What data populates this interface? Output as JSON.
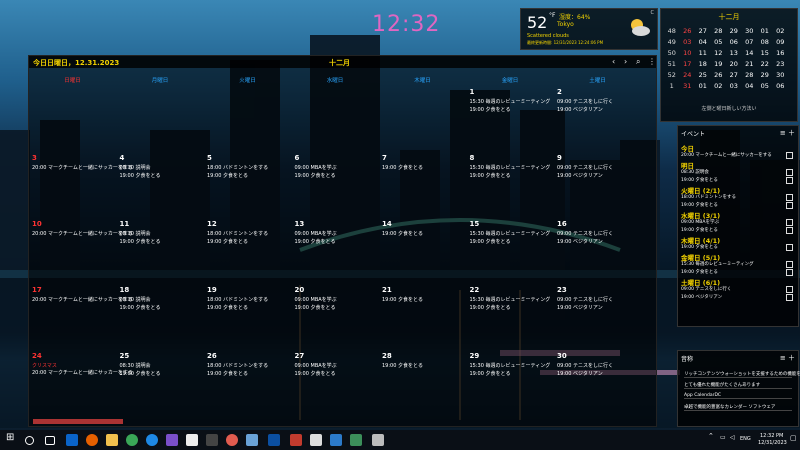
{
  "clock": "12:32",
  "weather": {
    "temp": "52",
    "unit": "°F",
    "humidity": "湿度：64%",
    "city": "Tokyo",
    "condition": "Scattered clouds",
    "updated": "最終更新時間: 12/31/2023 12:24:06 PM",
    "corner": "C"
  },
  "mini_calendar": {
    "title": "十二月",
    "rows": [
      [
        "48",
        "26",
        "27",
        "28",
        "29",
        "30",
        "01",
        "02"
      ],
      [
        "49",
        "03",
        "04",
        "05",
        "06",
        "07",
        "08",
        "09"
      ],
      [
        "50",
        "10",
        "11",
        "12",
        "13",
        "14",
        "15",
        "16"
      ],
      [
        "51",
        "17",
        "18",
        "19",
        "20",
        "21",
        "22",
        "23"
      ],
      [
        "52",
        "24",
        "25",
        "26",
        "27",
        "28",
        "29",
        "30"
      ],
      [
        "1",
        "31",
        "01",
        "02",
        "03",
        "04",
        "05",
        "06"
      ]
    ],
    "note": "左側と曜日新しい方法い"
  },
  "calendar": {
    "today_label": "今日日曜日，12.31.2023",
    "month": "十二月",
    "weekdays": [
      "日曜日",
      "月曜日",
      "火曜日",
      "水曜日",
      "木曜日",
      "金曜日",
      "土曜日"
    ],
    "weeks": [
      [
        {
          "day": "",
          "events": []
        },
        {
          "day": "",
          "events": []
        },
        {
          "day": "",
          "events": []
        },
        {
          "day": "",
          "events": []
        },
        {
          "day": "",
          "events": []
        },
        {
          "day": "1",
          "events": [
            "15:30 毎週のレビューミーティング",
            "19:00 夕食をとる"
          ]
        },
        {
          "day": "2",
          "events": [
            "09:00 テニスをしに行く",
            "19:00 ベジタリアン"
          ]
        }
      ],
      [
        {
          "day": "3",
          "events": [
            "20:00 マークチームと一緒にサッカーをする"
          ]
        },
        {
          "day": "4",
          "events": [
            "08:30 説明会",
            "19:00 夕食をとる"
          ]
        },
        {
          "day": "5",
          "events": [
            "18:00 バドミントンをする",
            "19:00 夕食をとる"
          ]
        },
        {
          "day": "6",
          "events": [
            "09:00 MBAを学ぶ",
            "19:00 夕食をとる"
          ]
        },
        {
          "day": "7",
          "events": [
            "19:00 夕食をとる"
          ]
        },
        {
          "day": "8",
          "events": [
            "15:30 毎週のレビューミーティング",
            "19:00 夕食をとる"
          ]
        },
        {
          "day": "9",
          "events": [
            "09:00 テニスをしに行く",
            "19:00 ベジタリアン"
          ]
        }
      ],
      [
        {
          "day": "10",
          "events": [
            "20:00 マークチームと一緒にサッカーをする"
          ]
        },
        {
          "day": "11",
          "events": [
            "08:30 説明会",
            "19:00 夕食をとる"
          ]
        },
        {
          "day": "12",
          "events": [
            "18:00 バドミントンをする",
            "19:00 夕食をとる"
          ]
        },
        {
          "day": "13",
          "events": [
            "09:00 MBAを学ぶ",
            "19:00 夕食をとる"
          ]
        },
        {
          "day": "14",
          "events": [
            "19:00 夕食をとる"
          ]
        },
        {
          "day": "15",
          "events": [
            "15:30 毎週のレビューミーティング",
            "19:00 夕食をとる"
          ]
        },
        {
          "day": "16",
          "events": [
            "09:00 テニスをしに行く",
            "19:00 ベジタリアン"
          ]
        }
      ],
      [
        {
          "day": "17",
          "events": [
            "20:00 マークチームと一緒にサッカーをする"
          ]
        },
        {
          "day": "18",
          "events": [
            "08:30 説明会",
            "19:00 夕食をとる"
          ]
        },
        {
          "day": "19",
          "events": [
            "18:00 バドミントンをする",
            "19:00 夕食をとる"
          ]
        },
        {
          "day": "20",
          "events": [
            "09:00 MBAを学ぶ",
            "19:00 夕食をとる"
          ]
        },
        {
          "day": "21",
          "events": [
            "19:00 夕食をとる"
          ]
        },
        {
          "day": "22",
          "events": [
            "15:30 毎週のレビューミーティング",
            "19:00 夕食をとる"
          ]
        },
        {
          "day": "23",
          "events": [
            "09:00 テニスをしに行く",
            "19:00 ベジタリアン"
          ]
        }
      ],
      [
        {
          "day": "24",
          "holiday": "クリスマス",
          "events": [
            "20:00 マークチームと一緒にサッカーをする"
          ]
        },
        {
          "day": "25",
          "events": [
            "08:30 説明会",
            "19:00 夕食をとる"
          ]
        },
        {
          "day": "26",
          "events": [
            "18:00 バドミントンをする",
            "19:00 夕食をとる"
          ]
        },
        {
          "day": "27",
          "events": [
            "09:00 MBAを学ぶ",
            "19:00 夕食をとる"
          ]
        },
        {
          "day": "28",
          "events": [
            "19:00 夕食をとる"
          ]
        },
        {
          "day": "29",
          "events": [
            "15:30 毎週のレビューミーティング",
            "19:00 夕食をとる"
          ]
        },
        {
          "day": "30",
          "events": [
            "09:00 テニスをしに行く",
            "19:00 ベジタリアン"
          ]
        }
      ]
    ]
  },
  "events_panel": {
    "title": "イベント",
    "groups": [
      {
        "label": "今日",
        "items": [
          "20:00 マークチームと一緒にサッカーをする"
        ]
      },
      {
        "label": "明日",
        "items": [
          "08:30 説明会",
          "19:00 夕食をとる"
        ]
      },
      {
        "label": "火曜日 (2/1)",
        "items": [
          "18:00 バドミントンをする",
          "19:00 夕食をとる"
        ]
      },
      {
        "label": "水曜日 (3/1)",
        "items": [
          "09:00 MBAを学ぶ",
          "19:00 夕食をとる"
        ]
      },
      {
        "label": "木曜日 (4/1)",
        "items": [
          "19:00 夕食をとる"
        ]
      },
      {
        "label": "金曜日 (5/1)",
        "items": [
          "15:30 毎週のレビューミーティング",
          "19:00 夕食をとる"
        ]
      },
      {
        "label": "土曜日 (6/1)",
        "items": [
          "09:00 テニスをしに行く",
          "19:00 ベジタリアン"
        ]
      }
    ]
  },
  "notes_panel": {
    "title": "音称",
    "lines": [
      "リッチコンテンツウォーショットを支援するための機能を",
      "とても優れた機能がたくさんあります",
      "App CalendarDC",
      "卓越で機能的豊富なカレンダー ソフトウェア"
    ]
  },
  "taskbar": {
    "lang": "ENG",
    "time": "12:32 PM",
    "date": "12/31/2023"
  }
}
